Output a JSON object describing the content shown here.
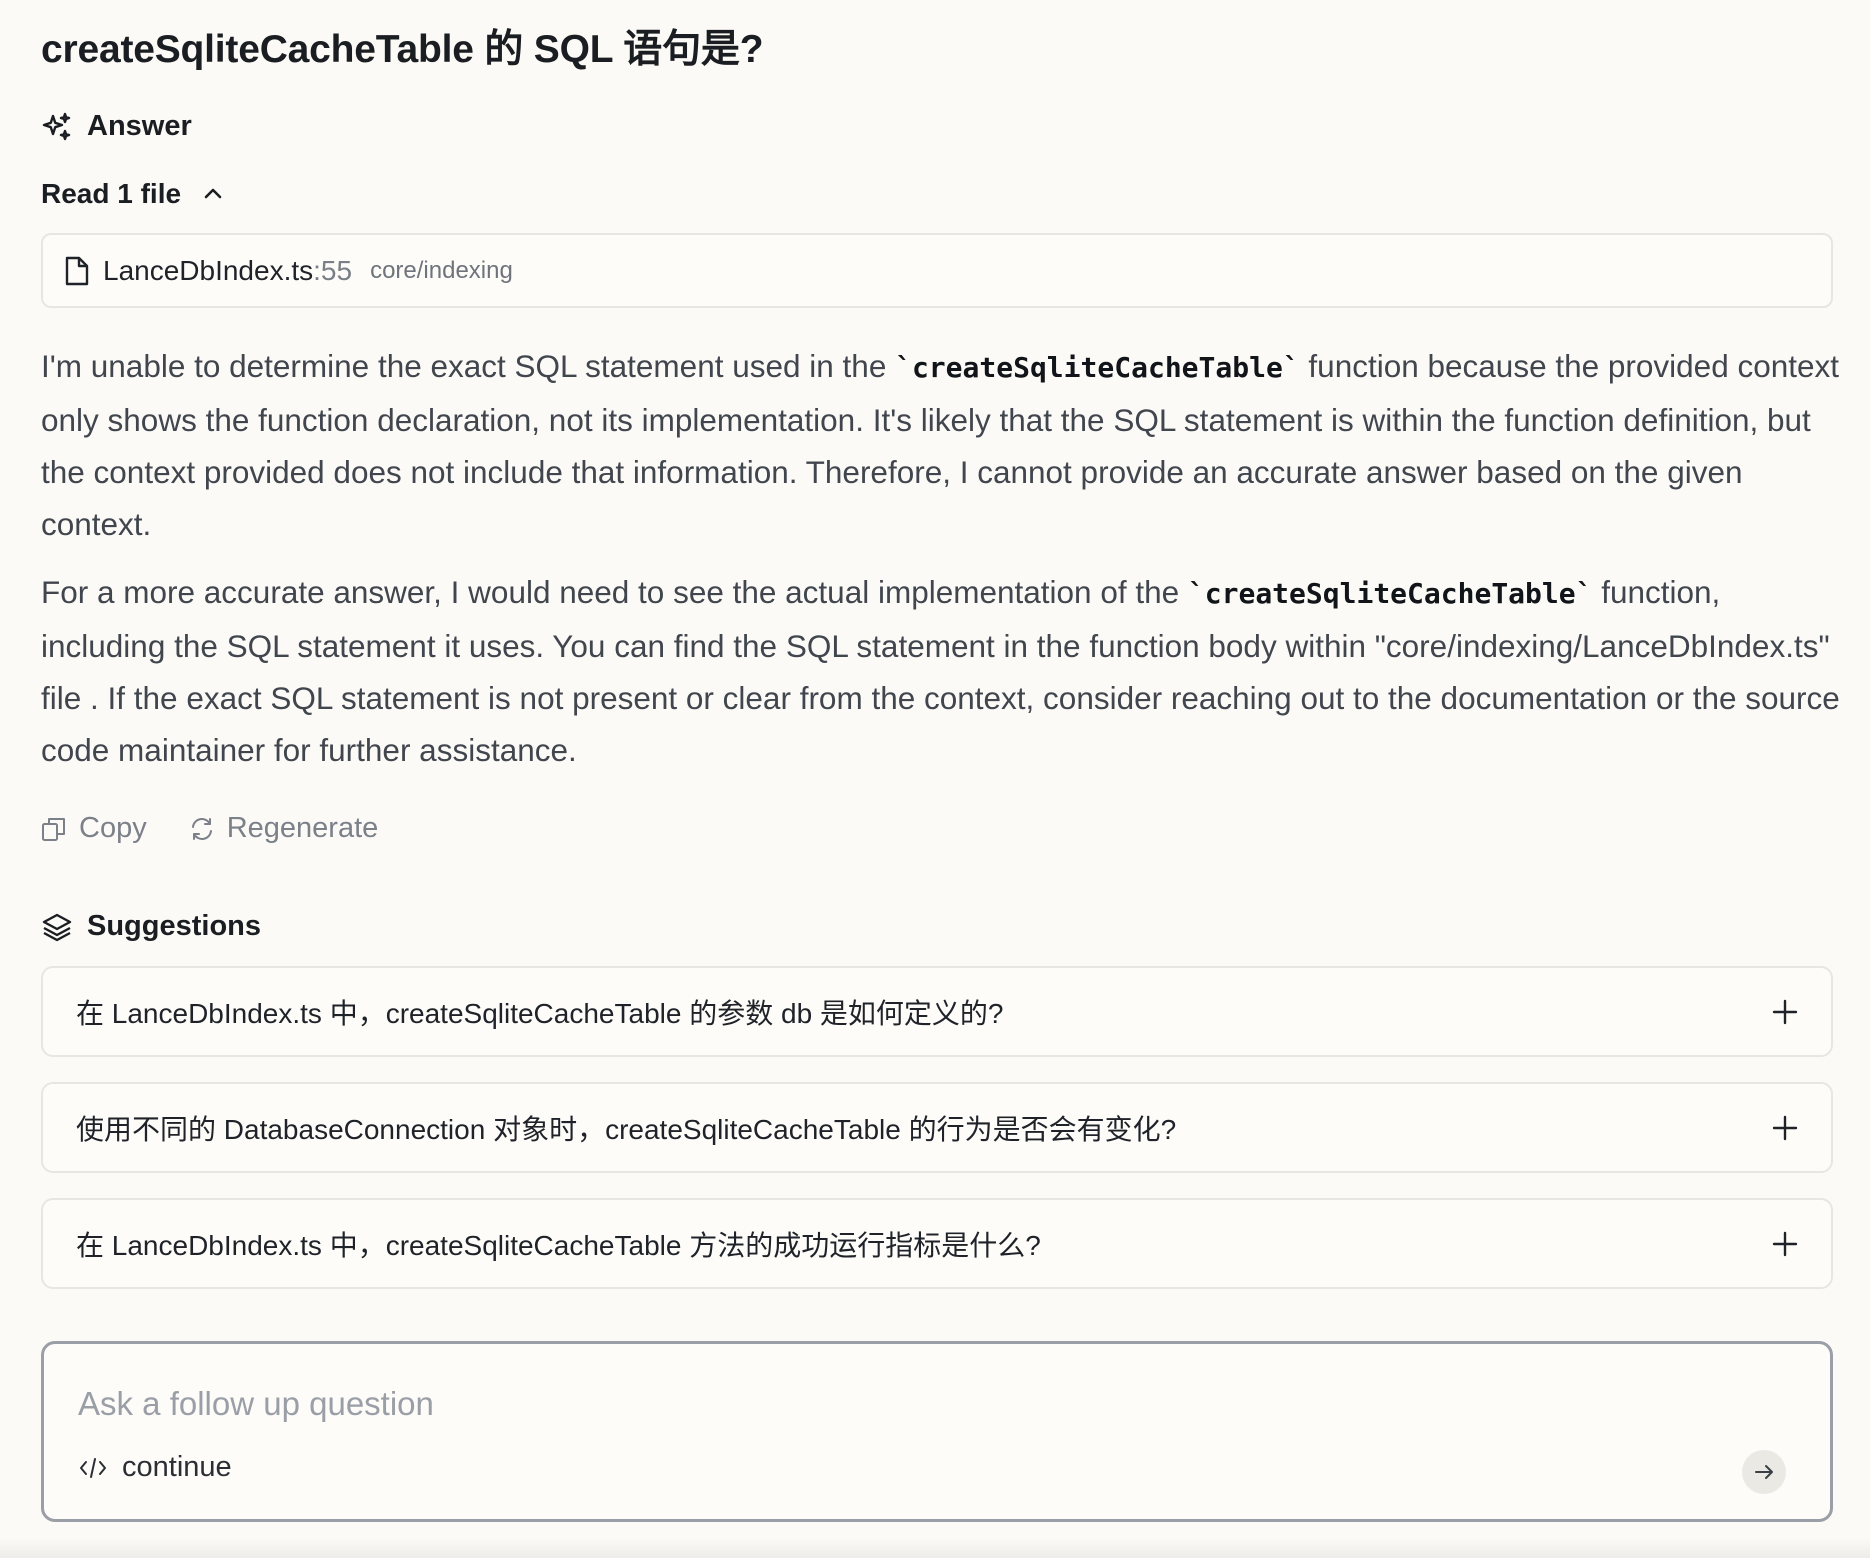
{
  "question": {
    "title": "createSqliteCacheTable 的 SQL 语句是?"
  },
  "answer_section": {
    "heading": "Answer",
    "icon": "sparkles-icon",
    "read_files_label": "Read 1 file",
    "files": [
      {
        "name": "LanceDbIndex.ts",
        "line": ":55",
        "path": "core/indexing"
      }
    ],
    "paragraph1": {
      "before": "I'm unable to determine the exact SQL statement used in the ",
      "code": "`createSqliteCacheTable`",
      "after": " function because the provided context only shows the function declaration, not its implementation. It's likely that the SQL statement is within the function definition, but the context provided does not include that information. Therefore, I cannot provide an accurate answer based on the given context."
    },
    "paragraph2": {
      "before": "For a more accurate answer, I would need to see the actual implementation of the ",
      "code": "`createSqliteCacheTable`",
      "after": " function, including the SQL statement it uses. You can find the SQL statement in the function body within \"core/indexing/LanceDbIndex.ts\" file . If the exact SQL statement is not present or clear from the context, consider reaching out to the documentation or the source code maintainer for further assistance."
    }
  },
  "actions": {
    "copy_label": "Copy",
    "regenerate_label": "Regenerate"
  },
  "suggestions": {
    "heading": "Suggestions",
    "icon": "layers-icon",
    "items": [
      "在 LanceDbIndex.ts 中，createSqliteCacheTable 的参数 db 是如何定义的?",
      "使用不同的 DatabaseConnection 对象时，createSqliteCacheTable 的行为是否会有变化?",
      "在 LanceDbIndex.ts 中，createSqliteCacheTable 方法的成功运行指标是什么?"
    ]
  },
  "composer": {
    "placeholder": "Ask a follow up question",
    "context_label": "continue",
    "context_icon": "code-icon",
    "send_icon": "arrow-right-icon"
  },
  "colors": {
    "background": "#fcfaf6",
    "text": "#1f2329",
    "muted": "#7b8089",
    "border": "#e8e6e1"
  }
}
